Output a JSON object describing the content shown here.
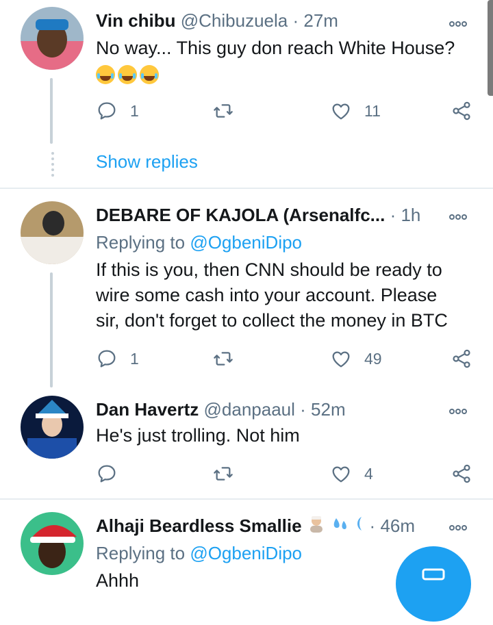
{
  "tweets": [
    {
      "name": "Vin chibu",
      "handle": "@Chibuzuela",
      "time": "27m",
      "text": "No way... This guy don reach White House?",
      "emoji": [
        "face-with-tears-of-joy",
        "face-with-tears-of-joy",
        "face-with-tears-of-joy"
      ],
      "replies": "1",
      "retweets": "",
      "likes": "11",
      "show_replies": "Show replies"
    },
    {
      "name": "DEBARE OF KAJOLA (Arsenalfc...",
      "time": "1h",
      "replying_prefix": "Replying to",
      "replying_to": "@OgbeniDipo",
      "text": "If this is you, then CNN should be ready to wire some cash into your account. Please sir, don't forget to collect the money in BTC",
      "replies": "1",
      "retweets": "",
      "likes": "49"
    },
    {
      "name": "Dan Havertz",
      "handle": "@danpaaul",
      "time": "52m",
      "text": "He's just trolling. Not him",
      "replies": "",
      "retweets": "",
      "likes": "4"
    },
    {
      "name": "Alhaji Beardless Smallie",
      "time": "46m",
      "replying_prefix": "Replying to",
      "replying_to": "@OgbeniDipo",
      "text": "Ahhh"
    }
  ],
  "colors": {
    "accent": "#1da1f2",
    "secondary_text": "#5b7083",
    "divider": "#e6ecf0"
  },
  "icons": [
    "reply-icon",
    "retweet-icon",
    "like-icon",
    "share-icon",
    "more-icon",
    "compose-icon"
  ]
}
